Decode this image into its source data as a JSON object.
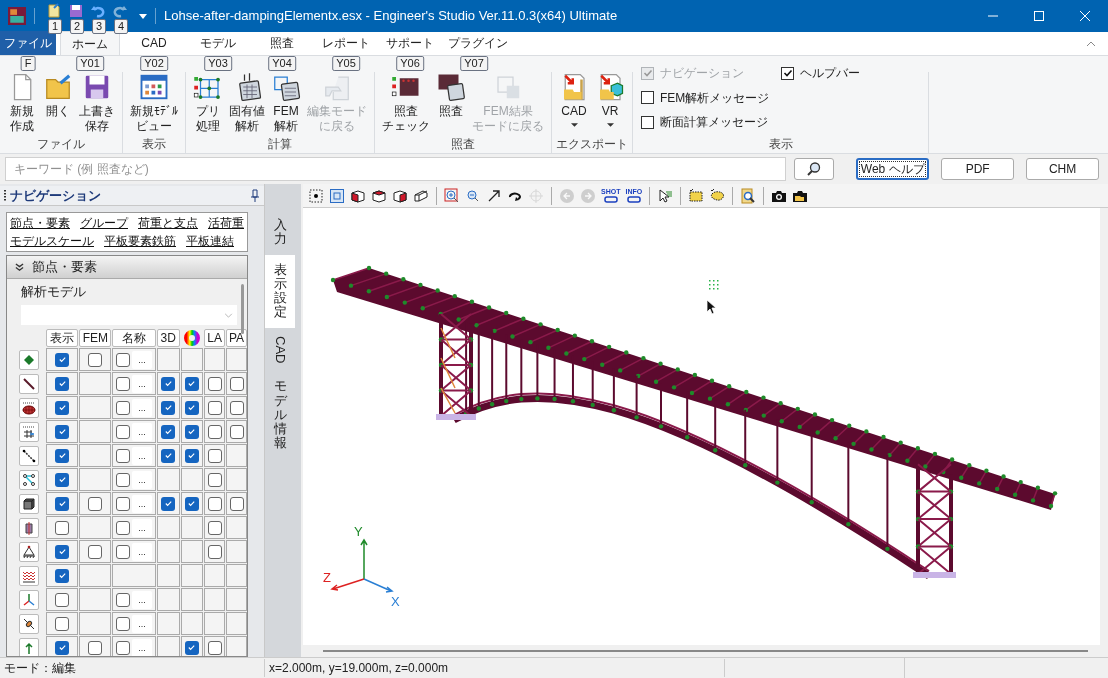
{
  "window": {
    "title": "Lohse-after-dampingElementx.esx - Engineer's Studio Ver.11.0.3(x64) Ultimate"
  },
  "quick_access": [
    {
      "kind": "new",
      "keytip": "1",
      "disabled": false
    },
    {
      "kind": "save",
      "keytip": "2",
      "disabled": false
    },
    {
      "kind": "undo",
      "keytip": "3",
      "disabled": false
    },
    {
      "kind": "redo",
      "keytip": "4",
      "disabled": true
    }
  ],
  "menu_tabs": [
    {
      "label": "ファイル",
      "keytip": "F",
      "kind": "file",
      "selected": false
    },
    {
      "label": "ホーム",
      "keytip": "Y01",
      "kind": "tab",
      "selected": true
    },
    {
      "label": "CAD",
      "keytip": "Y02",
      "kind": "tab",
      "selected": false
    },
    {
      "label": "モデル",
      "keytip": "Y03",
      "kind": "tab",
      "selected": false
    },
    {
      "label": "照査",
      "keytip": "Y04",
      "kind": "tab",
      "selected": false
    },
    {
      "label": "レポート",
      "keytip": "Y05",
      "kind": "tab",
      "selected": false
    },
    {
      "label": "サポート",
      "keytip": "Y06",
      "kind": "tab",
      "selected": false
    },
    {
      "label": "プラグイン",
      "keytip": "Y07",
      "kind": "tab",
      "selected": false
    }
  ],
  "ribbon": {
    "groups": [
      {
        "label": "ファイル",
        "kind": "buttons",
        "buttons": [
          {
            "lines": [
              "新規",
              "作成"
            ],
            "disabled": false
          },
          {
            "lines": [
              "開く"
            ],
            "disabled": false
          },
          {
            "lines": [
              "上書き",
              "保存"
            ],
            "disabled": false
          }
        ]
      },
      {
        "label": "表示",
        "kind": "buttons",
        "buttons": [
          {
            "lines": [
              "新規ﾓﾃﾞﾙ",
              "ビュー"
            ],
            "disabled": false
          }
        ]
      },
      {
        "label": "計算",
        "kind": "buttons",
        "buttons": [
          {
            "lines": [
              "プリ",
              "処理"
            ],
            "disabled": false
          },
          {
            "lines": [
              "固有値",
              "解析"
            ],
            "disabled": false
          },
          {
            "lines": [
              "FEM",
              "解析"
            ],
            "disabled": false
          },
          {
            "lines": [
              "編集モード",
              "に戻る"
            ],
            "disabled": true
          }
        ]
      },
      {
        "label": "照査",
        "kind": "buttons",
        "buttons": [
          {
            "lines": [
              "照査",
              "チェック"
            ],
            "disabled": false
          },
          {
            "lines": [
              "照査"
            ],
            "disabled": false
          },
          {
            "lines": [
              "FEM結果",
              "モードに戻る"
            ],
            "disabled": true
          }
        ]
      },
      {
        "label": "エクスポート",
        "kind": "buttons",
        "buttons": [
          {
            "lines": [
              "CAD"
            ],
            "disabled": false,
            "dropdown": true
          },
          {
            "lines": [
              "VR"
            ],
            "disabled": false,
            "dropdown": true
          }
        ]
      },
      {
        "label": "表示",
        "kind": "checks",
        "checks": [
          {
            "label": "ナビゲーション",
            "checked": true,
            "disabled": true
          },
          {
            "label": "FEM解析メッセージ",
            "checked": false,
            "disabled": false
          },
          {
            "label": "断面計算メッセージ",
            "checked": false,
            "disabled": false
          },
          {
            "label": "ヘルプバー",
            "checked": true,
            "disabled": false
          }
        ]
      }
    ]
  },
  "search": {
    "placeholder": "キーワード (例 照査など)"
  },
  "help_buttons": [
    {
      "label": "Web ヘルプ",
      "focused": true
    },
    {
      "label": "PDF",
      "focused": false
    },
    {
      "label": "CHM",
      "focused": false
    }
  ],
  "navigation": {
    "title": "ナビゲーション",
    "links": [
      "節点・要素",
      "グループ",
      "荷重と支点",
      "活荷重",
      "モデルスケール",
      "平板要素鉄筋",
      "平板連結"
    ],
    "section": {
      "title": "節点・要素",
      "expanded": true
    },
    "model_label": "解析モデル",
    "columns": [
      {
        "kind": "text",
        "label": "表示"
      },
      {
        "kind": "text",
        "label": "FEM"
      },
      {
        "kind": "text",
        "label": "名称"
      },
      {
        "kind": "text",
        "label": "3D"
      },
      {
        "kind": "colorwheel"
      },
      {
        "kind": "text",
        "label": "LA"
      },
      {
        "kind": "text",
        "label": "PA"
      }
    ],
    "rows": [
      {
        "show": true,
        "fem": false,
        "name": false,
        "name_more": "..."
      },
      {
        "show": true,
        "name": false,
        "name_more": "...",
        "d3": true,
        "color": true,
        "la": false,
        "pa": false
      },
      {
        "show": true,
        "name": false,
        "name_more": "...",
        "d3": true,
        "color": true,
        "la": false,
        "pa": false
      },
      {
        "show": true,
        "name": false,
        "name_more": "...",
        "d3": true,
        "color": true,
        "la": false,
        "pa": false
      },
      {
        "show": true,
        "name": false,
        "name_more": "...",
        "d3": true,
        "color": true,
        "la": false
      },
      {
        "show": true,
        "name": false,
        "name_more": "...",
        "la": false
      },
      {
        "show": true,
        "fem": false,
        "name": false,
        "name_more": "...",
        "d3": true,
        "color": true,
        "la": false,
        "pa": false
      },
      {
        "show": false,
        "name": false,
        "name_more": "...",
        "la": false
      },
      {
        "show": true,
        "fem": false,
        "name": false,
        "name_more": "...",
        "la": false
      },
      {
        "show": true
      },
      {
        "show": false,
        "name": false,
        "name_more": "..."
      },
      {
        "show": false,
        "name": false,
        "name_more": "..."
      },
      {
        "show": true,
        "fem": false,
        "name": false,
        "name_more": "...",
        "color": true,
        "la": false
      }
    ]
  },
  "vertical_tabs": [
    {
      "label": "入力",
      "kind": "cjk",
      "selected": false
    },
    {
      "label": "表示設定",
      "kind": "cjk",
      "selected": true
    },
    {
      "label": "CAD",
      "kind": "latin",
      "selected": false
    },
    {
      "label": "モデル情報",
      "kind": "cjk",
      "selected": false
    }
  ],
  "view": {
    "toolbar": [
      {
        "kind": "selpoint"
      },
      {
        "kind": "fit"
      },
      {
        "kind": "cube1"
      },
      {
        "kind": "cube2"
      },
      {
        "kind": "cube3"
      },
      {
        "kind": "cube4"
      },
      {
        "kind": "sep"
      },
      {
        "kind": "zoomwin"
      },
      {
        "kind": "zoomout"
      },
      {
        "kind": "arrow"
      },
      {
        "kind": "rotate"
      },
      {
        "kind": "center",
        "disabled": true
      },
      {
        "kind": "sep"
      },
      {
        "kind": "back",
        "disabled": true
      },
      {
        "kind": "forward",
        "disabled": true
      },
      {
        "kind": "text",
        "label": "SHOT"
      },
      {
        "kind": "text",
        "label": "INFO"
      },
      {
        "kind": "sep"
      },
      {
        "kind": "select"
      },
      {
        "kind": "sep"
      },
      {
        "kind": "rectsel"
      },
      {
        "kind": "lasso"
      },
      {
        "kind": "sep"
      },
      {
        "kind": "find"
      },
      {
        "kind": "sep"
      },
      {
        "kind": "camera"
      },
      {
        "kind": "camerafolder"
      }
    ],
    "axes": {
      "x": "X",
      "y": "Y",
      "z": "Z"
    }
  },
  "status_bar": [
    "モード：編集",
    "x=2.000m, y=19.000m, z=0.000m"
  ]
}
